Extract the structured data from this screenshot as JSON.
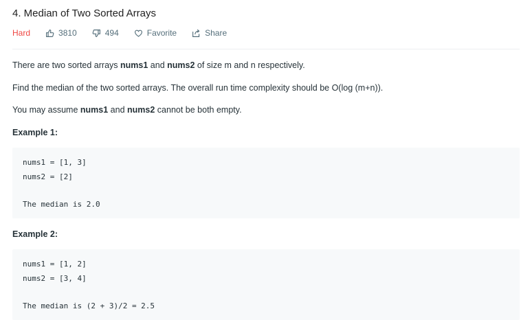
{
  "problem": {
    "title": "4. Median of Two Sorted Arrays",
    "difficulty": "Hard",
    "likes": "3810",
    "dislikes": "494",
    "favorite_label": "Favorite",
    "share_label": "Share"
  },
  "description": {
    "p1": {
      "a": "There are two sorted arrays ",
      "b1": "nums1",
      "c": " and ",
      "b2": "nums2",
      "d": " of size m and n respectively."
    },
    "p2": "Find the median of the two sorted arrays. The overall run time complexity should be O(log (m+n)).",
    "p3": {
      "a": "You may assume ",
      "b1": "nums1",
      "c": " and ",
      "b2": "nums2",
      "d": " cannot be both empty."
    }
  },
  "examples": [
    {
      "heading": "Example 1:",
      "line1": "nums1 = [1, 3]",
      "line2": "nums2 = [2]",
      "result": "The median is 2.0"
    },
    {
      "heading": "Example 2:",
      "line1": "nums1 = [1, 2]",
      "line2": "nums2 = [3, 4]",
      "result": "The median is (2 + 3)/2 = 2.5"
    }
  ],
  "colors": {
    "difficulty_hard": "#ef4743",
    "code_background": "#f7f9fa",
    "text": "#263238",
    "meta_text": "#546e7a"
  }
}
